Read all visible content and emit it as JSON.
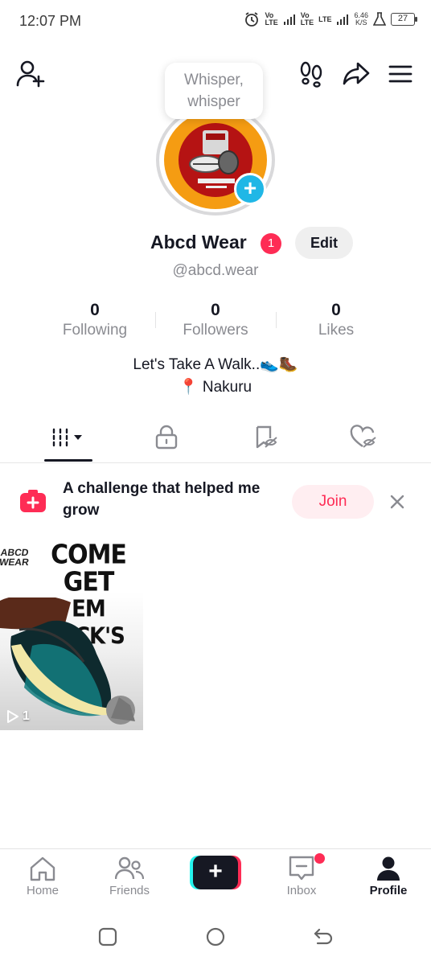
{
  "status_bar": {
    "time": "12:07 PM",
    "net1_top": "Vo",
    "net1_bottom": "LTE",
    "net2_top": "Vo",
    "net2_bottom": "LTE",
    "net3": "LTE",
    "speed_value": "6.46",
    "speed_unit": "K/S",
    "battery": "27"
  },
  "tooltip": {
    "text_line1": "Whisper,",
    "text_line2": "whisper"
  },
  "profile": {
    "display_name": "Abcd Wear",
    "badge_count": "1",
    "edit_label": "Edit",
    "handle": "@abcd.wear",
    "stats": [
      {
        "value": "0",
        "label": "Following"
      },
      {
        "value": "0",
        "label": "Followers"
      },
      {
        "value": "0",
        "label": "Likes"
      }
    ],
    "bio_line1": "Let's Take A Walk..👟🥾",
    "bio_line2": "📍 Nakuru"
  },
  "challenge": {
    "text": "A challenge that helped me grow",
    "join_label": "Join"
  },
  "video": {
    "brand_line1": "ABCD",
    "brand_line2": "WEAR",
    "headline_line1": "COME",
    "headline_line2": "GET",
    "headline_line3": "EM KICK'S",
    "play_count": "1"
  },
  "bottom_nav": {
    "items": [
      {
        "label": "Home",
        "icon": "home-icon"
      },
      {
        "label": "Friends",
        "icon": "friends-icon"
      },
      {
        "label": "",
        "icon": "plus-icon"
      },
      {
        "label": "Inbox",
        "icon": "inbox-icon"
      },
      {
        "label": "Profile",
        "icon": "profile-icon"
      }
    ]
  },
  "colors": {
    "accent": "#fe2c55",
    "cyan": "#25f4ee",
    "plus_badge": "#20b7e6",
    "text_primary": "#161823",
    "text_secondary": "#8a8b91"
  }
}
